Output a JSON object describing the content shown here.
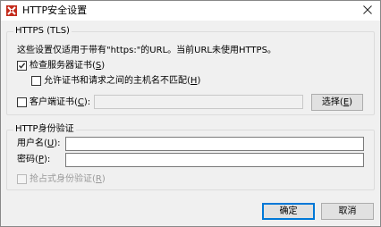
{
  "window": {
    "title": "HTTP安全设置",
    "close_glyph": "✕"
  },
  "https_group": {
    "legend": "HTTPS (TLS)",
    "note": "这些设置仅适用于带有\"https:\"的URL。当前URL未使用HTTPS。",
    "check_server_cert": {
      "label": "检查服务器证书(",
      "accel": "S",
      "close": ")",
      "checked": true
    },
    "allow_mismatch": {
      "label": "允许证书和请求之间的主机名不匹配(",
      "accel": "H",
      "close": ")",
      "checked": false
    },
    "client_cert": {
      "label": "客户端证书(",
      "accel": "C",
      "close": "):",
      "checked": false,
      "value": ""
    },
    "choose_button": {
      "label": "选择(",
      "accel": "E",
      "close": ")"
    }
  },
  "auth_group": {
    "legend": "HTTP身份验证",
    "username": {
      "label": "用户名(",
      "accel": "U",
      "close": "):",
      "value": ""
    },
    "password": {
      "label": "密码(",
      "accel": "P",
      "close": "):",
      "value": ""
    },
    "preemptive": {
      "label": "抢占式身份验证(",
      "accel": "R",
      "close": ")",
      "checked": false
    }
  },
  "footer": {
    "ok_label": "确定",
    "cancel_label": "取消"
  },
  "colors": {
    "accent": "#0078d7",
    "app_icon": "#c42b1c"
  }
}
